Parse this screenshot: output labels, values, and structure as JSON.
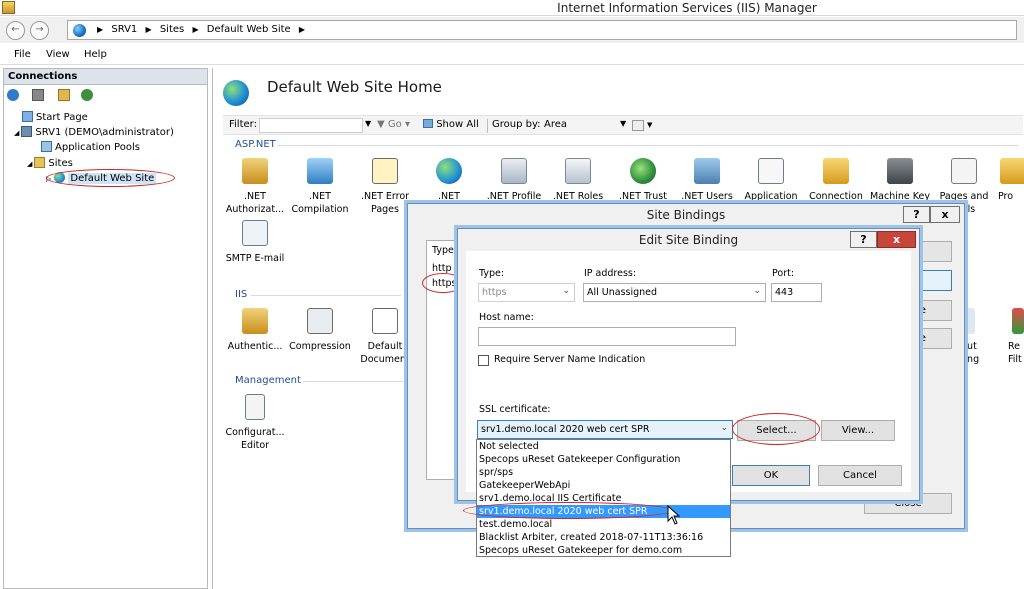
{
  "window": {
    "title": "Internet Information Services (IIS) Manager"
  },
  "address": {
    "crumbs": [
      "SRV1",
      "Sites",
      "Default Web Site"
    ]
  },
  "menu": {
    "items": [
      "File",
      "View",
      "Help"
    ]
  },
  "connections": {
    "header": "Connections",
    "tree": [
      {
        "label": "Start Page"
      },
      {
        "label": "SRV1 (DEMO\\administrator)"
      },
      {
        "label": "Application Pools"
      },
      {
        "label": "Sites"
      },
      {
        "label": "Default Web Site"
      }
    ]
  },
  "main": {
    "title": "Default Web Site Home",
    "filter": {
      "label": "Filter:",
      "go": "Go",
      "show_all": "Show All",
      "group_by_label": "Group by:",
      "group_by_value": "Area"
    },
    "sections": {
      "aspnet": "ASP.NET",
      "iis": "IIS",
      "management": "Management"
    },
    "aspnet_features": [
      {
        "line1": ".NET",
        "line2": "Authorizat...",
        "icon": "lock-user-icon"
      },
      {
        "line1": ".NET",
        "line2": "Compilation",
        "icon": "download-arrow-icon"
      },
      {
        "line1": ".NET Error",
        "line2": "Pages",
        "icon": "warning-404-icon"
      },
      {
        "line1": ".NET",
        "line2": "",
        "icon": "globe-icon"
      },
      {
        "line1": ".NET Profile",
        "line2": "",
        "icon": "profile-icon"
      },
      {
        "line1": ".NET Roles",
        "line2": "",
        "icon": "roles-icon"
      },
      {
        "line1": ".NET Trust",
        "line2": "",
        "icon": "trust-icon"
      },
      {
        "line1": ".NET Users",
        "line2": "",
        "icon": "users-icon"
      },
      {
        "line1": "Application",
        "line2": "",
        "icon": "app-settings-icon"
      },
      {
        "line1": "Connection",
        "line2": "",
        "icon": "connection-icon"
      },
      {
        "line1": "Machine Key",
        "line2": "",
        "icon": "machine-key-icon"
      },
      {
        "line1": "Pages and",
        "line2": "...ols",
        "icon": "pages-icon"
      },
      {
        "line1": "Pro",
        "line2": "",
        "icon": "providers-icon"
      }
    ],
    "smtp": {
      "line1": "SMTP E-mail",
      "icon": "smtp-icon"
    },
    "iis_features": [
      {
        "line1": "Authentic...",
        "line2": "",
        "icon": "auth-icon"
      },
      {
        "line1": "Compression",
        "line2": "",
        "icon": "compression-icon"
      },
      {
        "line1": "Default",
        "line2": "Document",
        "icon": "default-doc-icon"
      }
    ],
    "iis_right_fragments": [
      {
        "line1": "...ut",
        "line2": "...ng"
      },
      {
        "line1": "Re",
        "line2": "Filt"
      }
    ],
    "management_features": [
      {
        "line1": "Configurat...",
        "line2": "Editor",
        "icon": "config-editor-icon"
      }
    ]
  },
  "site_bindings": {
    "title": "Site Bindings",
    "help": "?",
    "close": "x",
    "column_type": "Type",
    "rows": [
      "http",
      "https"
    ],
    "close_button": "Close",
    "right_button_fragments": [
      "e",
      "e"
    ]
  },
  "edit_binding": {
    "title": "Edit Site Binding",
    "help": "?",
    "close": "x",
    "type_label": "Type:",
    "type_value": "https",
    "ip_label": "IP address:",
    "ip_value": "All Unassigned",
    "port_label": "Port:",
    "port_value": "443",
    "host_label": "Host name:",
    "host_value": "",
    "sni_label": "Require Server Name Indication",
    "sni_checked": false,
    "ssl_label": "SSL certificate:",
    "ssl_value": "srv1.demo.local 2020 web cert SPR",
    "select_button": "Select...",
    "view_button": "View...",
    "ok_button": "OK",
    "cancel_button": "Cancel",
    "ssl_options": [
      "Not selected",
      "Specops uReset Gatekeeper Configuration",
      "spr/sps",
      "GatekeeperWebApi",
      "srv1.demo.local IIS Certificate",
      "srv1.demo.local 2020 web cert SPR",
      "test.demo.local",
      "Blacklist Arbiter, created 2018-07-11T13:36:16",
      "Specops uReset Gatekeeper for demo.com"
    ],
    "ssl_selected_index": 5
  },
  "colors": {
    "accent": "#3399ff",
    "annotation": "#d42323",
    "section": "#1f4e99",
    "dialog_border": "#9cc3ea"
  }
}
